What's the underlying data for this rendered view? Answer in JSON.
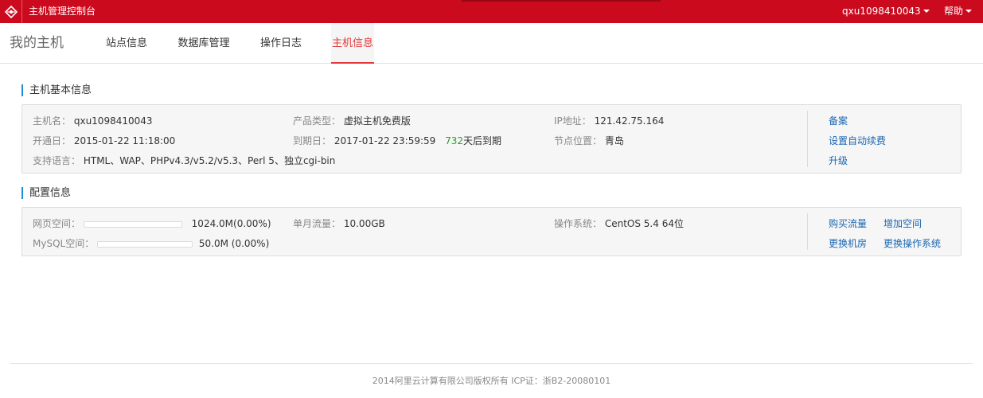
{
  "topbar": {
    "title": "主机管理控制台",
    "username": "qxu1098410043",
    "help": "帮助",
    "accent": "#cc0a1e"
  },
  "nav": {
    "brand": "我的主机",
    "tabs": [
      {
        "label": "站点信息",
        "active": false
      },
      {
        "label": "数据库管理",
        "active": false
      },
      {
        "label": "操作日志",
        "active": false
      },
      {
        "label": "主机信息",
        "active": true
      }
    ]
  },
  "basic": {
    "title": "主机基本信息",
    "hostname_label": "主机名：",
    "hostname": "qxu1098410043",
    "product_label": "产品类型：",
    "product": "虚拟主机免费版",
    "ip_label": "IP地址：",
    "ip": "121.42.75.164",
    "open_label": "开通日：",
    "open_date": "2015-01-22 11:18:00",
    "expire_label": "到期日：",
    "expire_date": "2017-01-22 23:59:59",
    "days_left": "732",
    "days_suffix": "天后到期",
    "node_label": "节点位置：",
    "node": "青岛",
    "lang_label": "支持语言：",
    "languages": "HTML、WAP、PHPv4.3/v5.2/v5.3、Perl 5、独立cgi-bin",
    "actions": [
      "备案",
      "设置自动续费",
      "升级"
    ]
  },
  "config": {
    "title": "配置信息",
    "web_label": "网页空间：",
    "web_value": "1024.0M(0.00%)",
    "web_usage_percent": 0,
    "traffic_label": "单月流量：",
    "traffic": "10.00GB",
    "os_label": "操作系统：",
    "os": "CentOS 5.4 64位",
    "mysql_label": "MySQL空间：",
    "mysql_value": "50.0M (0.00%)",
    "mysql_usage_percent": 0,
    "actions": [
      "购买流量",
      "增加空间",
      "更换机房",
      "更换操作系统"
    ]
  },
  "footer": {
    "text": "2014阿里云计算有限公司版权所有 ICP证：浙B2-20080101"
  }
}
